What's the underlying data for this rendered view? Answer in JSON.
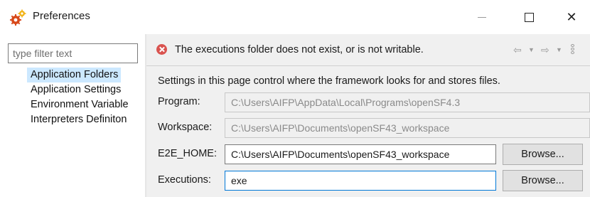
{
  "window": {
    "title": "Preferences",
    "icon": "gears-icon",
    "controls": {
      "minimize": "minimize-icon",
      "maximize": "maximize-icon",
      "close": "close-icon",
      "close_glyph": "✕"
    }
  },
  "sidebar": {
    "filter": {
      "placeholder": "type filter text",
      "value": ""
    },
    "items": [
      {
        "label": "Application Folders",
        "selected": true
      },
      {
        "label": "Application Settings",
        "selected": false
      },
      {
        "label": "Environment Variable",
        "selected": false
      },
      {
        "label": "Interpreters Definiton",
        "selected": false
      }
    ]
  },
  "page": {
    "message": "The executions folder does not exist, or is not writable.",
    "message_type": "error",
    "nav": {
      "back": "⇦",
      "back_dropdown": "▼",
      "forward": "⇨",
      "forward_dropdown": "▼",
      "more": "view-menu-icon"
    },
    "description": "Settings in this page control where the framework looks for and stores files.",
    "fields": {
      "program": {
        "label": "Program:",
        "value": "C:\\Users\\AIFP\\AppData\\Local\\Programs\\openSF4.3",
        "enabled": false
      },
      "workspace": {
        "label": "Workspace:",
        "value": "C:\\Users\\AIFP\\Documents\\openSF43_workspace",
        "enabled": false
      },
      "e2e_home": {
        "label": "E2E_HOME:",
        "value": "C:\\Users\\AIFP\\Documents\\openSF43_workspace",
        "enabled": true,
        "button": "Browse..."
      },
      "executions": {
        "label": "Executions:",
        "value": "exe",
        "enabled": true,
        "focused": true,
        "button": "Browse..."
      }
    }
  },
  "colors": {
    "error": "#d9534f",
    "selection": "#cce8ff",
    "focus_border": "#0078d7",
    "panel_background": "#f0f0f0"
  }
}
